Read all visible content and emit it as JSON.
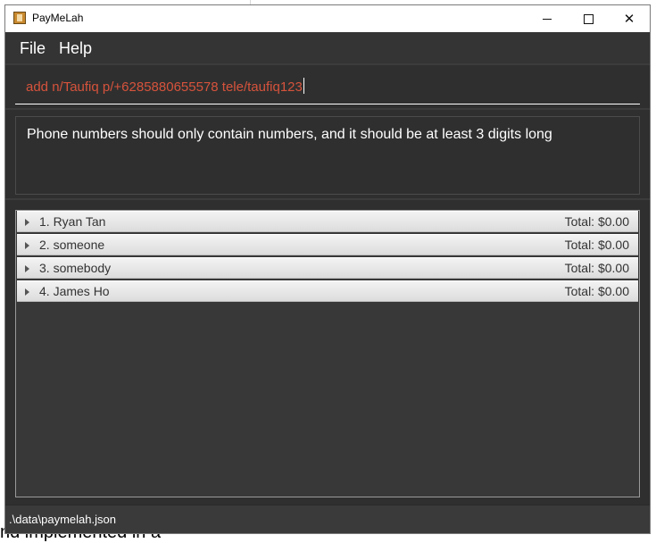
{
  "window": {
    "title": "PayMeLah",
    "controls": [
      "minimize-icon",
      "maximize-icon",
      "close-icon"
    ]
  },
  "menu": {
    "file_label": "File",
    "help_label": "Help"
  },
  "command": {
    "value": "add n/Taufiq p/+6285880655578 tele/taufiq123",
    "text_color": "#d6533c"
  },
  "result": {
    "message": "Phone numbers should only contain numbers, and it should be at least 3 digits long"
  },
  "persons": [
    {
      "label": "1. Ryan Tan",
      "total": "Total: $0.00"
    },
    {
      "label": "2. someone",
      "total": "Total: $0.00"
    },
    {
      "label": "3. somebody",
      "total": "Total: $0.00"
    },
    {
      "label": "4. James Ho",
      "total": "Total: $0.00"
    }
  ],
  "status": {
    "file_path": ".\\data\\paymelah.json"
  },
  "background": {
    "peek_text": "nd implemented in a"
  }
}
